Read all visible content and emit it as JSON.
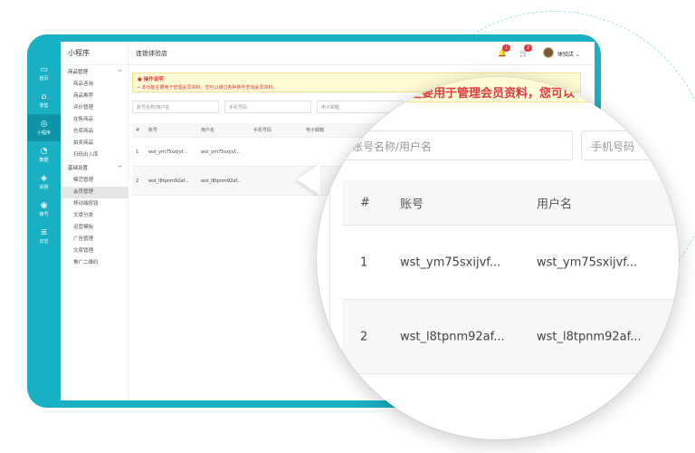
{
  "app": {
    "menu_title": "小程序",
    "shop_name": "连锁体验店",
    "bell_badge": "1",
    "cart_badge": "2",
    "username": "体验店"
  },
  "rail": [
    {
      "icon": "home-icon",
      "label": "首页"
    },
    {
      "icon": "shop-icon",
      "label": "零售"
    },
    {
      "icon": "mini-program-icon",
      "label": "小程序"
    },
    {
      "icon": "chart-icon",
      "label": "数据"
    },
    {
      "icon": "purchase-icon",
      "label": "采购"
    },
    {
      "icon": "account-icon",
      "label": "账号"
    },
    {
      "icon": "log-icon",
      "label": "日志"
    }
  ],
  "menu": {
    "group1": "商品管理",
    "group1_items": [
      "商品咨询",
      "商品推荐",
      "评价管理",
      "在售商品",
      "仓库商品",
      "拍卖商品",
      "扫码出入库"
    ],
    "group2": "基础设置",
    "group2_items": [
      "模范管理",
      "会员管理",
      "移动端按钮",
      "文章分类",
      "运营模板",
      "广告管理",
      "文章管理",
      "推广二维码"
    ]
  },
  "notice": {
    "title": "操作说明",
    "text": "本功能主要用于管理会员资料，您可以通过各种条件查询会员资料。"
  },
  "filters": {
    "account": "账号名称/用户名",
    "phone": "手机号码",
    "email": "电子邮箱"
  },
  "table": {
    "headers": [
      "#",
      "账号",
      "用户名",
      "手机号码",
      "电子邮箱"
    ],
    "rows": [
      {
        "num": "1",
        "account": "wst_ym75sxijvf...",
        "user": "wst_ym75sxijvf..."
      },
      {
        "num": "2",
        "account": "wst_l8tpnm92af...",
        "user": "wst_l8tpnm92af..."
      }
    ]
  },
  "lens": {
    "notice_text": "能主要用于管理会员资料，您可以",
    "input_account": "账号名称/用户名",
    "input_phone": "手机号码",
    "headers": [
      "#",
      "账号",
      "用户名"
    ],
    "rows": [
      {
        "num": "1",
        "account": "wst_ym75sxijvf...",
        "user": "wst_ym75sxijvf..."
      },
      {
        "num": "2",
        "account": "wst_l8tpnm92af...",
        "user": "wst_l8tpnm92af..."
      }
    ]
  },
  "colors": {
    "brand": "#1ab0c4",
    "notice_bg": "#fffbd6",
    "notice_text": "#e4393c"
  }
}
